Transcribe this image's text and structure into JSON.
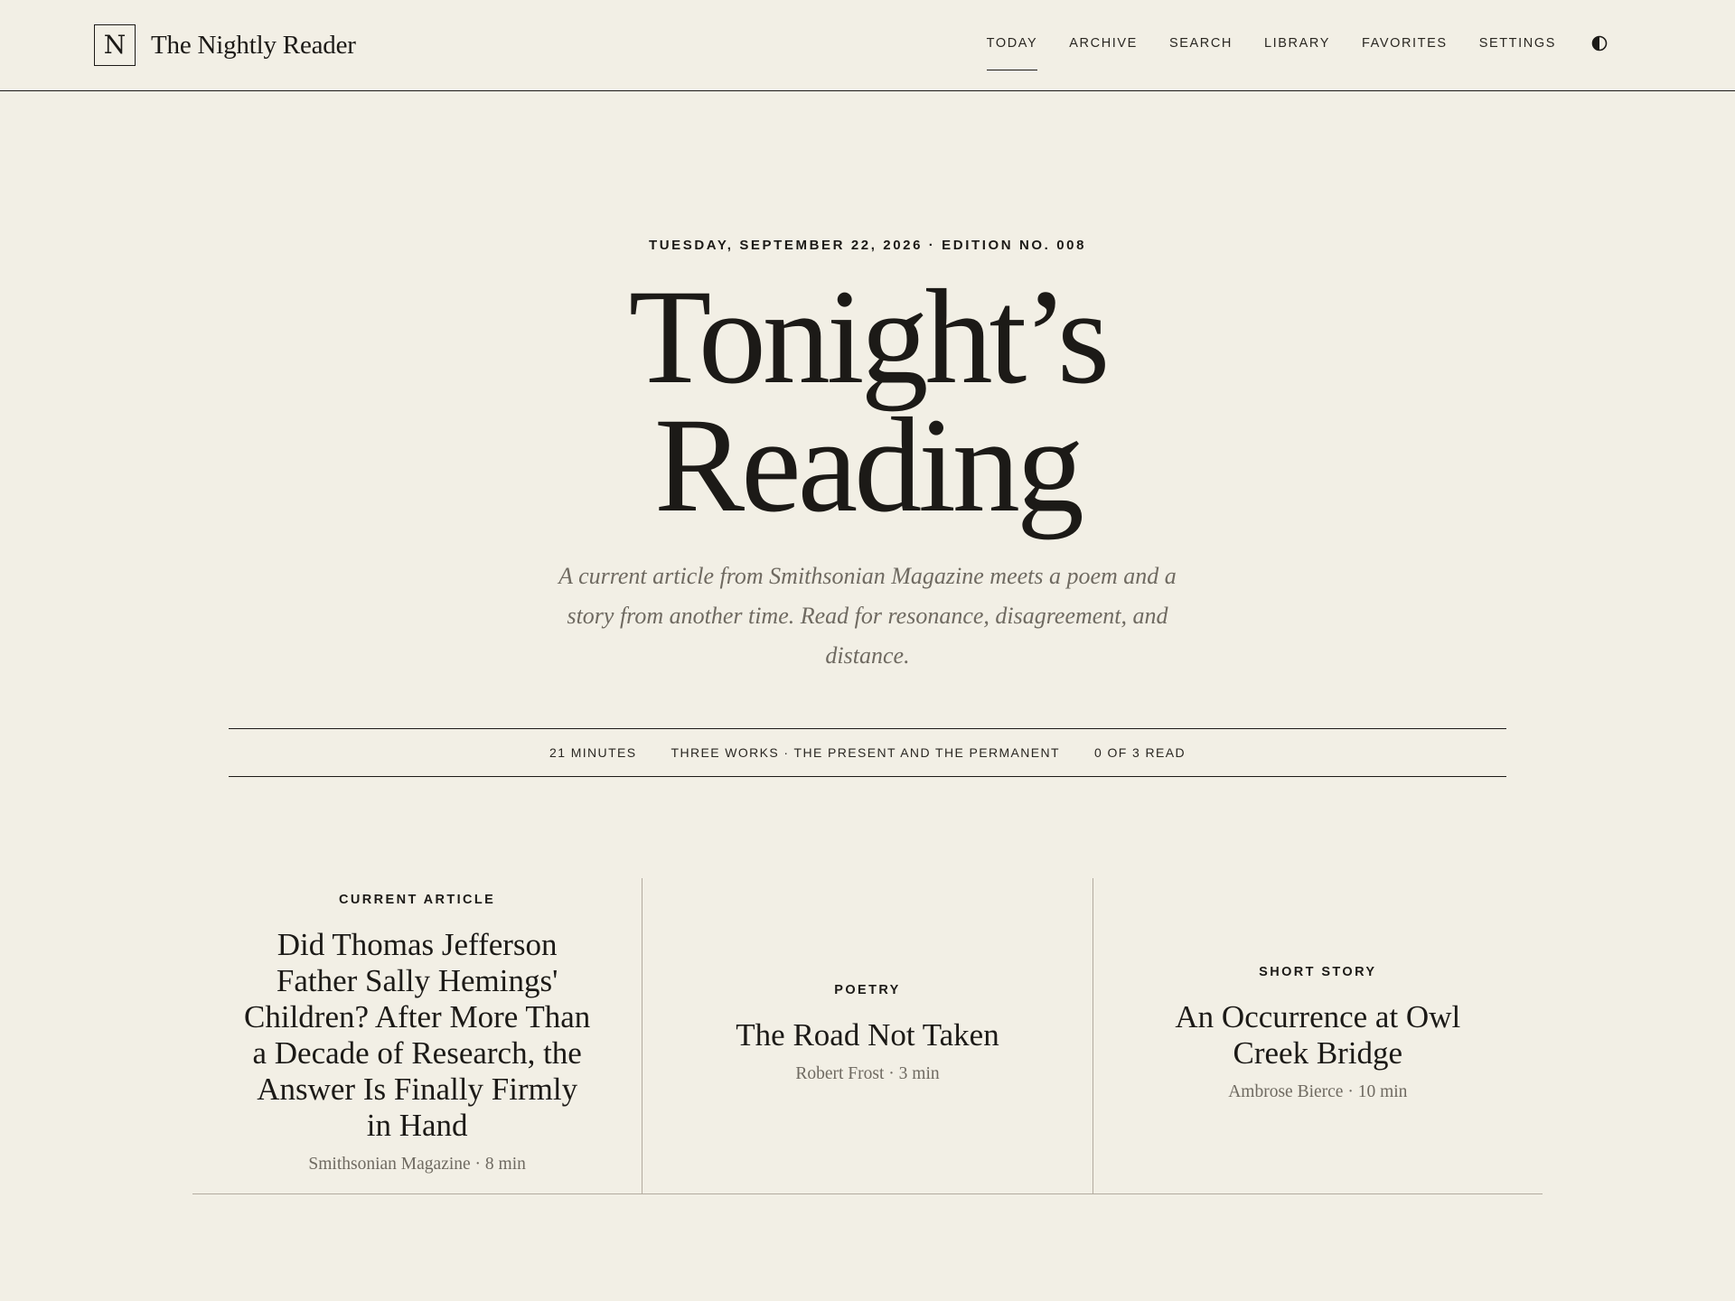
{
  "header": {
    "brand_mark": "N",
    "brand_name": "The Nightly Reader",
    "nav": [
      {
        "label": "TODAY",
        "active": true
      },
      {
        "label": "ARCHIVE"
      },
      {
        "label": "SEARCH"
      },
      {
        "label": "LIBRARY"
      },
      {
        "label": "FAVORITES"
      },
      {
        "label": "SETTINGS"
      }
    ],
    "theme_toggle_icon": "half-circle-contrast-icon"
  },
  "hero": {
    "dateline": "TUESDAY, SEPTEMBER 22, 2026 · EDITION NO. 008",
    "title_line1": "Tonight’s",
    "title_line2": "Reading",
    "subtitle": "A current article from Smithsonian Magazine meets a poem and a story from another time. Read for resonance, disagreement, and distance."
  },
  "meta": {
    "duration": "21 MINUTES",
    "theme": "THREE WORKS · THE PRESENT AND THE PERMANENT",
    "progress": "0 OF 3 READ"
  },
  "cards": [
    {
      "label": "CURRENT ARTICLE",
      "title": "Did Thomas Jefferson Father Sally Hemings' Children? After More Than a Decade of Research, the Answer Is Finally Firmly in Hand",
      "meta": "Smithsonian Magazine · 8 min"
    },
    {
      "label": "POETRY",
      "title": "The Road Not Taken",
      "meta": "Robert Frost · 3 min"
    },
    {
      "label": "SHORT STORY",
      "title": "An Occurrence at Owl Creek Bridge",
      "meta": "Ambrose Bierce · 10 min"
    }
  ],
  "colors": {
    "background": "#f2efe5",
    "ink": "#1c1a17",
    "muted": "#6f6a61",
    "rule": "#b3ab9f"
  }
}
